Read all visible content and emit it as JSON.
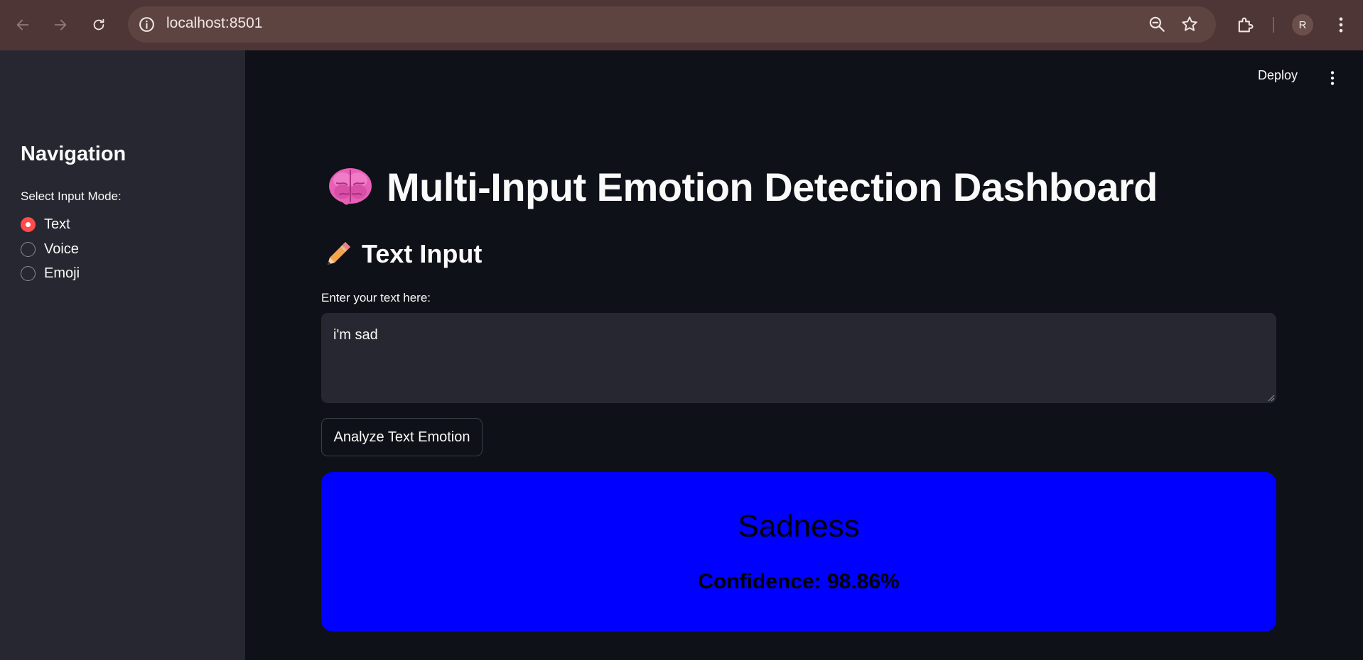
{
  "browser": {
    "url": "localhost:8501",
    "profile_initial": "R",
    "icons": [
      "back-icon",
      "forward-icon",
      "reload-icon",
      "info-icon",
      "zoom-icon",
      "star-icon",
      "extensions-icon",
      "more-vert-icon"
    ]
  },
  "sidebar": {
    "title": "Navigation",
    "radio_label": "Select Input Mode:",
    "options": [
      {
        "label": "Text",
        "selected": true
      },
      {
        "label": "Voice",
        "selected": false
      },
      {
        "label": "Emoji",
        "selected": false
      }
    ],
    "accent_color": "#ff4b4b"
  },
  "header": {
    "deploy_label": "Deploy"
  },
  "main": {
    "title_icon": "brain-icon",
    "title": "Multi-Input Emotion Detection Dashboard",
    "section_icon": "pencil-icon",
    "section_title": "Text Input",
    "input_label": "Enter your text here:",
    "input_value": "i'm sad",
    "analyze_button": "Analyze Text Emotion"
  },
  "result": {
    "emotion": "Sadness",
    "confidence_text": "Confidence: 98.86%",
    "background_color": "#0000ff"
  }
}
